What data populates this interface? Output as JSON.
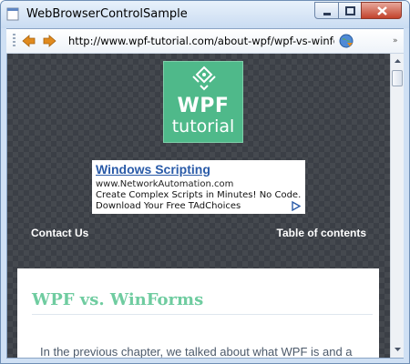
{
  "window": {
    "title": "WebBrowserControlSample"
  },
  "toolbar": {
    "back_icon": "back-arrow-icon",
    "forward_icon": "forward-arrow-icon",
    "url": "http://www.wpf-tutorial.com/about-wpf/wpf-vs-winforr",
    "go_icon": "go-globe-icon",
    "accent": "#e08a1e"
  },
  "page": {
    "logo": {
      "line1": "WPF",
      "line2": "tutorial",
      "bg": "#4fb98a"
    },
    "ad": {
      "title": "Windows Scripting",
      "url": "www.NetworkAutomation.com",
      "text": "Create Complex Scripts in Minutes! No Code. Download Your Free TAdChoices"
    },
    "nav": {
      "contact": "Contact Us",
      "toc": "Table of contents"
    },
    "article": {
      "title": "WPF vs. WinForms",
      "intro": "In the previous chapter, we talked about what WPF is and a"
    }
  }
}
